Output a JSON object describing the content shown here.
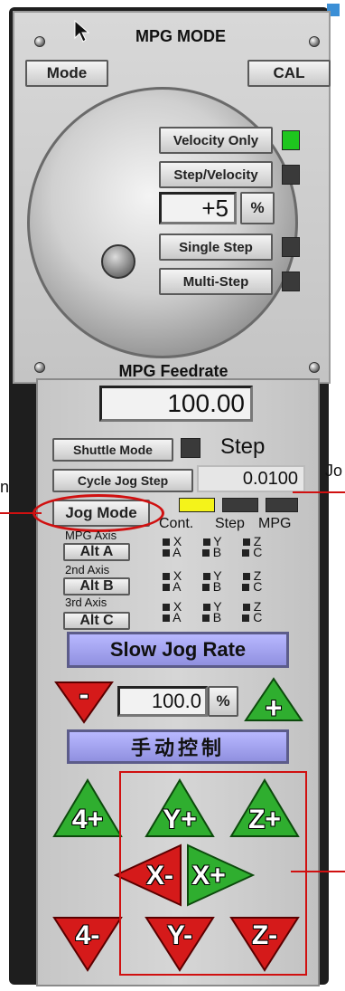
{
  "mpg": {
    "title": "MPG MODE",
    "mode_label": "Mode",
    "cal_label": "CAL",
    "velocity_only_label": "Velocity Only",
    "step_velocity_label": "Step/Velocity",
    "step_value": "+5",
    "percent_label": "%",
    "single_step_label": "Single Step",
    "multi_step_label": "Multi-Step",
    "feedrate_title": "MPG Feedrate",
    "feedrate_value": "100.00"
  },
  "jog": {
    "shuttle_mode_label": "Shuttle Mode",
    "step_label": "Step",
    "cycle_jog_step_label": "Cycle Jog Step",
    "jog_step_value": "0.0100",
    "jog_mode_label": "Jog Mode",
    "mode_headers": [
      "Cont.",
      "Step",
      "MPG"
    ],
    "mpg_axis_label": "MPG Axis",
    "second_axis_label": "2nd Axis",
    "third_axis_label": "3rd Axis",
    "alt_a_label": "Alt A",
    "alt_b_label": "Alt B",
    "alt_c_label": "Alt C",
    "axis_grid": [
      [
        "X",
        "Y",
        "Z"
      ],
      [
        "A",
        "B",
        "C"
      ]
    ],
    "slow_jog_label": "Slow Jog Rate",
    "minus_label": "-",
    "plus_label": "+",
    "jog_rate_value": "100.0",
    "jog_rate_pct": "%",
    "manual_control_label": "手动控制",
    "buttons": {
      "a_plus": "4+",
      "y_plus": "Y+",
      "z_plus": "Z+",
      "x_minus": "X-",
      "x_plus": "X+",
      "a_minus": "4-",
      "y_minus": "Y-",
      "z_minus": "Z-"
    }
  },
  "annotations": {
    "left_cut": "n",
    "right_cut": "Jo"
  },
  "colors": {
    "led_on": "#1ec61e",
    "led_yellow": "#f4f31a",
    "jog_green": "#2fae2f",
    "jog_red": "#d51a1a",
    "annotation_red": "#d01010",
    "lcd_blue": "#a4a4f0"
  }
}
